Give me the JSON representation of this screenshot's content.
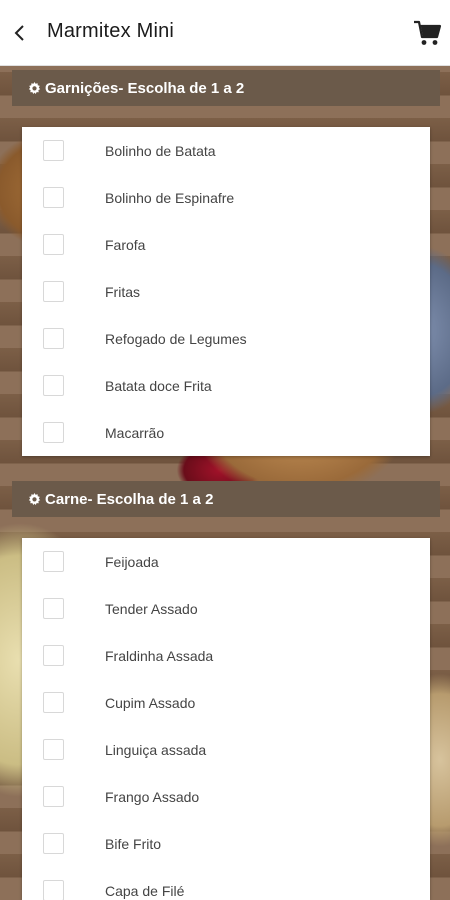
{
  "header": {
    "title": "Marmitex Mini",
    "back_icon": "chevron-left-icon",
    "cart_icon": "cart-icon"
  },
  "sections": [
    {
      "title": "Garnições- Escolha de 1 a 2",
      "icon": "gear-icon",
      "items": [
        {
          "label": "Bolinho de Batata",
          "checked": false
        },
        {
          "label": "Bolinho de Espinafre",
          "checked": false
        },
        {
          "label": "Farofa",
          "checked": false
        },
        {
          "label": "Fritas",
          "checked": false
        },
        {
          "label": "Refogado de Legumes",
          "checked": false
        },
        {
          "label": "Batata doce Frita",
          "checked": false
        },
        {
          "label": "Macarrão",
          "checked": false
        }
      ]
    },
    {
      "title": "Carne- Escolha de 1 a 2",
      "icon": "gear-icon",
      "items": [
        {
          "label": "Feijoada",
          "checked": false
        },
        {
          "label": "Tender Assado",
          "checked": false
        },
        {
          "label": "Fraldinha Assada",
          "checked": false
        },
        {
          "label": "Cupim Assado",
          "checked": false
        },
        {
          "label": "Linguiça assada",
          "checked": false
        },
        {
          "label": "Frango Assado",
          "checked": false
        },
        {
          "label": "Bife Frito",
          "checked": false
        },
        {
          "label": "Capa de Filé",
          "checked": false
        }
      ]
    }
  ],
  "colors": {
    "section_header_bg": "#6b5a4a",
    "section_header_text": "#ffffff",
    "item_text": "#444444",
    "checkbox_border": "#d8d8d8"
  }
}
